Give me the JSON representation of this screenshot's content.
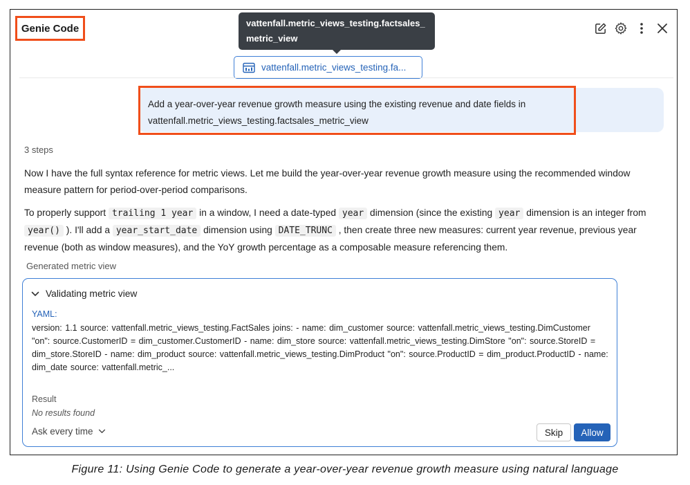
{
  "app": {
    "title": "Genie Code"
  },
  "tooltip": {
    "text": "vattenfall.metric_views_testing.factsales_metric_view"
  },
  "context_chip": {
    "label": "vattenfall.metric_views_testing.fa...",
    "icon": "table-icon"
  },
  "toolbar": {
    "icons": [
      "edit-icon",
      "gear-icon",
      "more-vertical-icon",
      "close-icon"
    ]
  },
  "user_message": {
    "text": "Add a year-over-year revenue growth measure using the existing revenue and date fields in vattenfall.metric_views_testing.factsales_metric_view"
  },
  "assistant": {
    "steps": "3 steps",
    "para1": "Now I have the full syntax reference for metric views. Let me build the year-over-year revenue growth measure using the recommended window measure pattern for period-over-period comparisons.",
    "para2": {
      "t1": "To properly support ",
      "c1": "trailing 1 year",
      "t2": " in a window, I need a date-typed ",
      "c2": "year",
      "t3": " dimension (since the existing ",
      "c3": "year",
      "t4": " dimension is an integer from ",
      "c4": "year()",
      "t5": " ). I'll add a ",
      "c5": "year_start_date",
      "t6": " dimension using ",
      "c6": "DATE_TRUNC",
      "t7": " , then create three new measures: current year revenue, previous year revenue (both as window measures), and the YoY growth percentage as a composable measure referencing them."
    },
    "generated_label": "Generated metric view"
  },
  "card": {
    "title": "Validating metric view",
    "yaml_label": "YAML:",
    "yaml_body": "version:  1.1  source:  vattenfall.metric_views_testing.FactSales  joins: - name: dim_customer source: vattenfall.metric_views_testing.DimCustomer  \"on\": source.CustomerID = dim_customer.CustomerID - name: dim_store source: vattenfall.metric_views_testing.DimStore  \"on\": source.StoreID = dim_store.StoreID - name: dim_product source: vattenfall.metric_views_testing.DimProduct  \"on\": source.ProductID = dim_product.ProductID - name: dim_date source: vattenfall.metric_...",
    "result_label": "Result",
    "result_value": "No results found",
    "ask_option": "Ask every time",
    "skip_label": "Skip",
    "allow_label": "Allow"
  },
  "caption": "Figure 11:  Using Genie Code to generate a year-over-year revenue growth measure using natural language",
  "colors": {
    "accent_blue": "#2563b8",
    "highlight_orange": "#f04e1a",
    "user_bubble": "#e8f0fb",
    "tooltip_bg": "#3a3f45"
  }
}
